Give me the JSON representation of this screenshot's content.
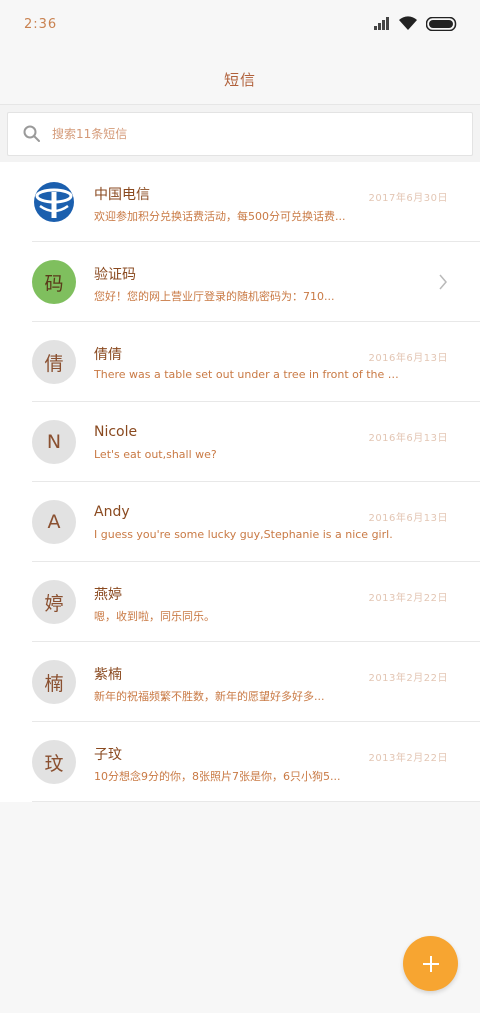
{
  "status_bar": {
    "time": "2:36"
  },
  "header": {
    "title": "短信"
  },
  "search": {
    "placeholder": "搜索11条短信"
  },
  "conversations": [
    {
      "name": "中国电信",
      "date": "2017年6月30日",
      "preview": "欢迎参加积分兑换话费活动，每500分可兑换话费...",
      "avatar": "telecom-logo"
    },
    {
      "name": "验证码",
      "date": "",
      "preview": "您好！您的网上营业厅登录的随机密码为：710...",
      "avatar": "码"
    },
    {
      "name": "倩倩",
      "date": "2016年6月13日",
      "preview": "There was a table set out under a tree in front of the house",
      "avatar": "倩"
    },
    {
      "name": "Nicole",
      "date": "2016年6月13日",
      "preview": "Let's eat out,shall we?",
      "avatar": "N"
    },
    {
      "name": "Andy",
      "date": "2016年6月13日",
      "preview": "I guess you're some lucky guy,Stephanie is a nice girl.",
      "avatar": "A"
    },
    {
      "name": "燕婷",
      "date": "2013年2月22日",
      "preview": "嗯，收到啦，同乐同乐。",
      "avatar": "婷"
    },
    {
      "name": "紫楠",
      "date": "2013年2月22日",
      "preview": "新年的祝福频繁不胜数，新年的愿望好多好多...",
      "avatar": "楠"
    },
    {
      "name": "子玟",
      "date": "2013年2月22日",
      "preview": "10分想念9分的你，8张照片7张是你，6只小狗5...",
      "avatar": "玟"
    }
  ],
  "colors": {
    "accent": "#f7a531",
    "name": "#8a4a20",
    "preview": "#c97a45",
    "date": "#e3c6b4"
  }
}
